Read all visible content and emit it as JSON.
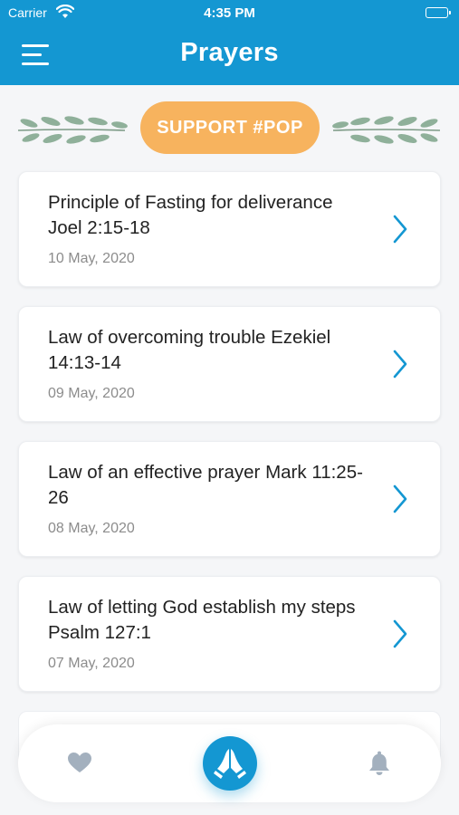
{
  "status_bar": {
    "carrier": "Carrier",
    "time": "4:35 PM",
    "icons": [
      "wifi-icon",
      "battery-icon"
    ]
  },
  "nav": {
    "title": "Prayers",
    "menu_icon": "hamburger-menu-icon"
  },
  "banner": {
    "support_label": "SUPPORT #POP",
    "support_color": "#f7b35e",
    "decoration_icons": [
      "olive-branch-icon",
      "olive-branch-icon"
    ]
  },
  "prayers": [
    {
      "title": "Principle of Fasting for deliverance Joel 2:15-18",
      "date": "10 May, 2020"
    },
    {
      "title": "Law of overcoming trouble Ezekiel 14:13-14",
      "date": "09 May, 2020"
    },
    {
      "title": "Law of an effective prayer Mark 11:25-26",
      "date": "08 May, 2020"
    },
    {
      "title": "Law of letting God establish my steps Psalm 127:1",
      "date": "07 May, 2020"
    }
  ],
  "tab_bar": {
    "tabs": [
      {
        "icon": "heart-icon",
        "active": false
      },
      {
        "icon": "praying-hands-icon",
        "active": true
      },
      {
        "icon": "bell-icon",
        "active": false
      }
    ]
  },
  "colors": {
    "primary": "#1497d2",
    "accent": "#f7b35e",
    "inactive_icon": "#a3b0be"
  }
}
